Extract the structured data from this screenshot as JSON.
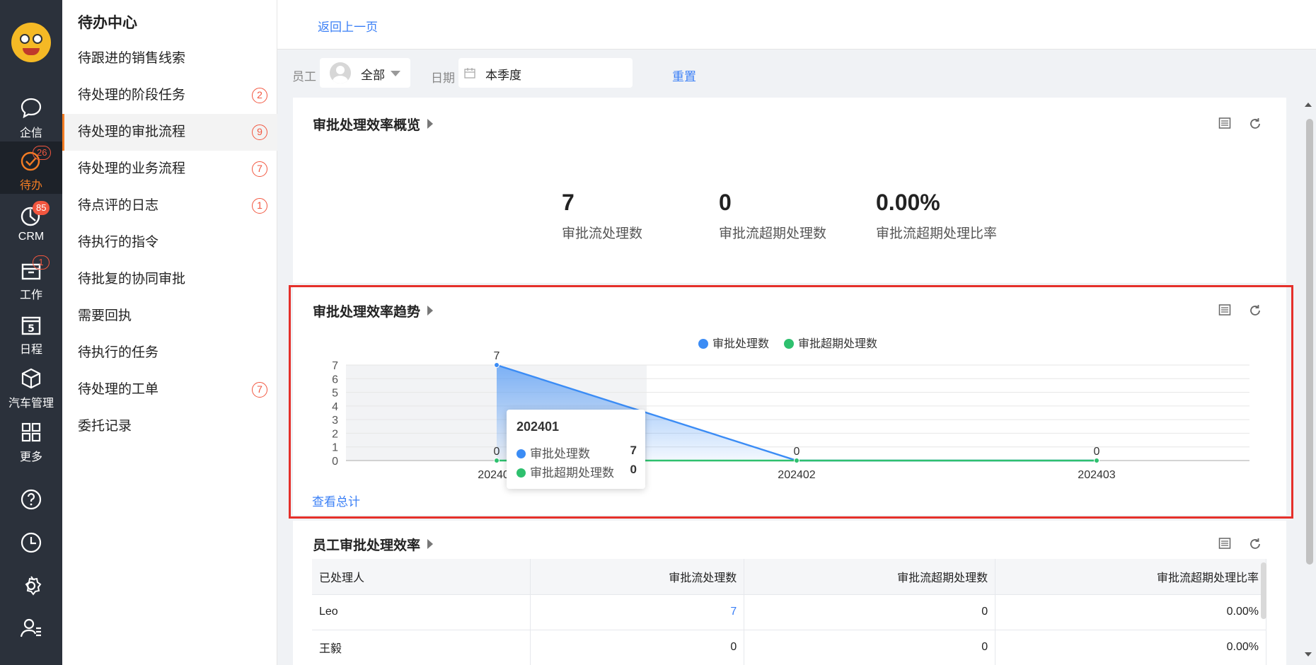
{
  "rail": {
    "items": [
      {
        "label": "企信",
        "icon": "chat-bubble-icon"
      },
      {
        "label": "待办",
        "icon": "check-circle-icon",
        "badge": "26"
      },
      {
        "label": "CRM",
        "icon": "pie-clock-icon",
        "badge": "85"
      },
      {
        "label": "工作",
        "icon": "briefcase-icon",
        "badge": "1"
      },
      {
        "label": "日程",
        "icon": "calendar-icon",
        "day": "5"
      },
      {
        "label": "汽车管理",
        "icon": "cube-icon"
      },
      {
        "label": "更多",
        "icon": "grid-icon"
      }
    ],
    "bottom_icons": [
      "help-icon",
      "history-icon",
      "settings-icon",
      "user-admin-icon"
    ]
  },
  "sidebar": {
    "title": "待办中心",
    "items": [
      {
        "label": "待跟进的销售线索",
        "count": ""
      },
      {
        "label": "待处理的阶段任务",
        "count": "2"
      },
      {
        "label": "待处理的审批流程",
        "count": "9"
      },
      {
        "label": "待处理的业务流程",
        "count": "7"
      },
      {
        "label": "待点评的日志",
        "count": "1"
      },
      {
        "label": "待执行的指令",
        "count": ""
      },
      {
        "label": "待批复的协同审批",
        "count": ""
      },
      {
        "label": "需要回执",
        "count": ""
      },
      {
        "label": "待执行的任务",
        "count": ""
      },
      {
        "label": "待处理的工单",
        "count": "7"
      },
      {
        "label": "委托记录",
        "count": ""
      }
    ]
  },
  "header": {
    "back_label": "返回上一页"
  },
  "filters": {
    "employee_label": "员工",
    "employee_value": "全部",
    "date_label": "日期",
    "date_value": "本季度",
    "reset_label": "重置"
  },
  "overview": {
    "title": "审批处理效率概览",
    "kpis": [
      {
        "value": "7",
        "caption": "审批流处理数"
      },
      {
        "value": "0",
        "caption": "审批流超期处理数"
      },
      {
        "value": "0.00%",
        "caption": "审批流超期处理比率"
      }
    ]
  },
  "trend": {
    "title": "审批处理效率趋势",
    "view_total_label": "查看总计",
    "tooltip": {
      "title": "202401",
      "rows": [
        {
          "label": "审批处理数",
          "value": "7"
        },
        {
          "label": "审批超期处理数",
          "value": "0"
        }
      ]
    }
  },
  "chart_data": {
    "type": "line",
    "categories": [
      "202401",
      "202402",
      "202403"
    ],
    "series": [
      {
        "name": "审批处理数",
        "values": [
          7,
          0,
          0
        ],
        "color": "#3b8cf5"
      },
      {
        "name": "审批超期处理数",
        "values": [
          0,
          0,
          0
        ],
        "color": "#2ec06e"
      }
    ],
    "yticks": [
      "0",
      "1",
      "2",
      "3",
      "4",
      "5",
      "6",
      "7"
    ],
    "ylim": [
      0,
      7
    ],
    "legend_position": "top-center",
    "grid": true
  },
  "employee_table": {
    "title": "员工审批处理效率",
    "columns": [
      "已处理人",
      "审批流处理数",
      "审批流超期处理数",
      "审批流超期处理比率"
    ],
    "rows": [
      [
        "Leo",
        "7",
        "0",
        "0.00%"
      ],
      [
        "王毅",
        "0",
        "0",
        "0.00%"
      ]
    ]
  },
  "colors": {
    "accent": "#f47d24",
    "link": "#3a7ff6",
    "highlight_border": "#e5302a"
  }
}
